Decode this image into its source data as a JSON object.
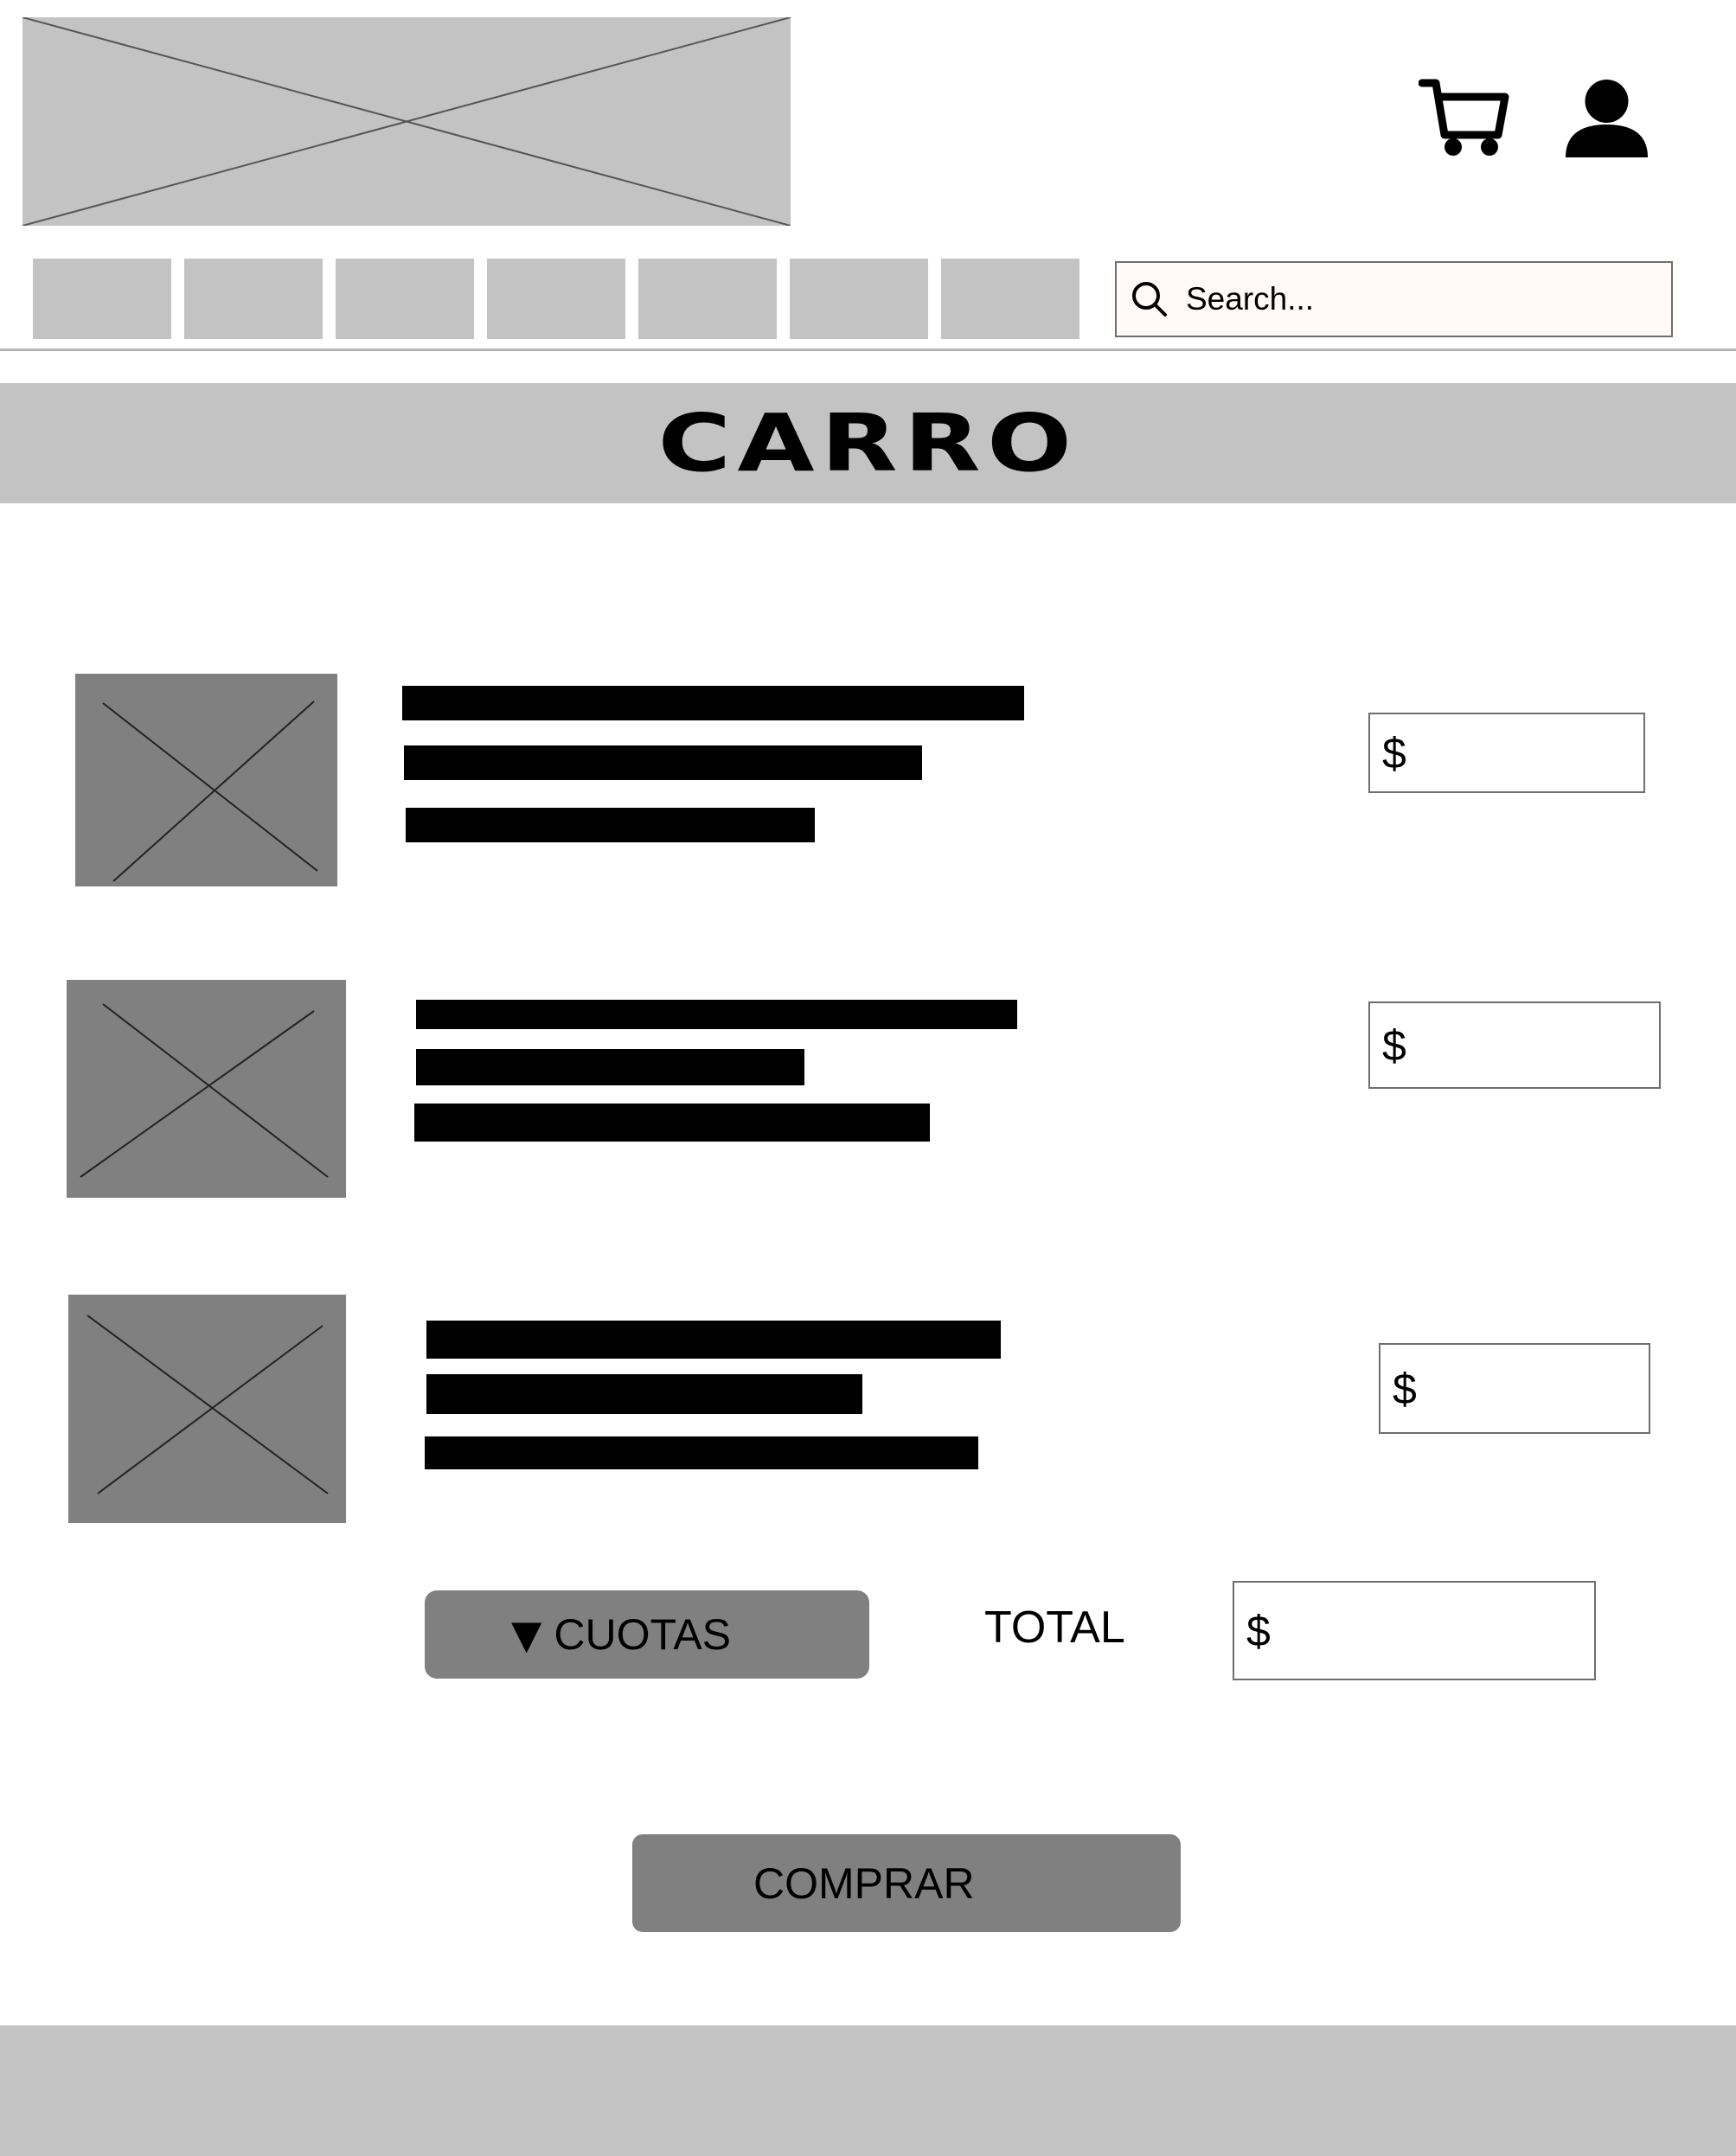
{
  "search": {
    "placeholder": "Search..."
  },
  "banner": {
    "title": "CARRO"
  },
  "items": [
    {
      "currency": "$"
    },
    {
      "currency": "$"
    },
    {
      "currency": "$"
    }
  ],
  "summary": {
    "cuotas_arrow": "▼",
    "cuotas_label": "CUOTAS",
    "total_label": "TOTAL",
    "total_currency": "$"
  },
  "actions": {
    "buy_label": "COMPRAR"
  },
  "icons": {
    "cart": "cart-icon",
    "user": "user-icon",
    "search": "search-icon"
  },
  "colors": {
    "placeholder": "#c3c3c3",
    "thumbnail": "#808080",
    "bars": "#000000",
    "search_bg": "#fffaf8"
  }
}
